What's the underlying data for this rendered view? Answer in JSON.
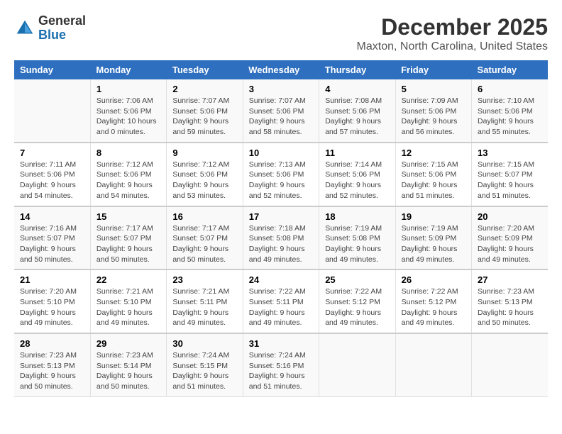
{
  "header": {
    "logo_general": "General",
    "logo_blue": "Blue",
    "month_title": "December 2025",
    "location": "Maxton, North Carolina, United States"
  },
  "days_of_week": [
    "Sunday",
    "Monday",
    "Tuesday",
    "Wednesday",
    "Thursday",
    "Friday",
    "Saturday"
  ],
  "weeks": [
    [
      {
        "num": "",
        "info": ""
      },
      {
        "num": "1",
        "info": "Sunrise: 7:06 AM\nSunset: 5:06 PM\nDaylight: 10 hours\nand 0 minutes."
      },
      {
        "num": "2",
        "info": "Sunrise: 7:07 AM\nSunset: 5:06 PM\nDaylight: 9 hours\nand 59 minutes."
      },
      {
        "num": "3",
        "info": "Sunrise: 7:07 AM\nSunset: 5:06 PM\nDaylight: 9 hours\nand 58 minutes."
      },
      {
        "num": "4",
        "info": "Sunrise: 7:08 AM\nSunset: 5:06 PM\nDaylight: 9 hours\nand 57 minutes."
      },
      {
        "num": "5",
        "info": "Sunrise: 7:09 AM\nSunset: 5:06 PM\nDaylight: 9 hours\nand 56 minutes."
      },
      {
        "num": "6",
        "info": "Sunrise: 7:10 AM\nSunset: 5:06 PM\nDaylight: 9 hours\nand 55 minutes."
      }
    ],
    [
      {
        "num": "7",
        "info": "Sunrise: 7:11 AM\nSunset: 5:06 PM\nDaylight: 9 hours\nand 54 minutes."
      },
      {
        "num": "8",
        "info": "Sunrise: 7:12 AM\nSunset: 5:06 PM\nDaylight: 9 hours\nand 54 minutes."
      },
      {
        "num": "9",
        "info": "Sunrise: 7:12 AM\nSunset: 5:06 PM\nDaylight: 9 hours\nand 53 minutes."
      },
      {
        "num": "10",
        "info": "Sunrise: 7:13 AM\nSunset: 5:06 PM\nDaylight: 9 hours\nand 52 minutes."
      },
      {
        "num": "11",
        "info": "Sunrise: 7:14 AM\nSunset: 5:06 PM\nDaylight: 9 hours\nand 52 minutes."
      },
      {
        "num": "12",
        "info": "Sunrise: 7:15 AM\nSunset: 5:06 PM\nDaylight: 9 hours\nand 51 minutes."
      },
      {
        "num": "13",
        "info": "Sunrise: 7:15 AM\nSunset: 5:07 PM\nDaylight: 9 hours\nand 51 minutes."
      }
    ],
    [
      {
        "num": "14",
        "info": "Sunrise: 7:16 AM\nSunset: 5:07 PM\nDaylight: 9 hours\nand 50 minutes."
      },
      {
        "num": "15",
        "info": "Sunrise: 7:17 AM\nSunset: 5:07 PM\nDaylight: 9 hours\nand 50 minutes."
      },
      {
        "num": "16",
        "info": "Sunrise: 7:17 AM\nSunset: 5:07 PM\nDaylight: 9 hours\nand 50 minutes."
      },
      {
        "num": "17",
        "info": "Sunrise: 7:18 AM\nSunset: 5:08 PM\nDaylight: 9 hours\nand 49 minutes."
      },
      {
        "num": "18",
        "info": "Sunrise: 7:19 AM\nSunset: 5:08 PM\nDaylight: 9 hours\nand 49 minutes."
      },
      {
        "num": "19",
        "info": "Sunrise: 7:19 AM\nSunset: 5:09 PM\nDaylight: 9 hours\nand 49 minutes."
      },
      {
        "num": "20",
        "info": "Sunrise: 7:20 AM\nSunset: 5:09 PM\nDaylight: 9 hours\nand 49 minutes."
      }
    ],
    [
      {
        "num": "21",
        "info": "Sunrise: 7:20 AM\nSunset: 5:10 PM\nDaylight: 9 hours\nand 49 minutes."
      },
      {
        "num": "22",
        "info": "Sunrise: 7:21 AM\nSunset: 5:10 PM\nDaylight: 9 hours\nand 49 minutes."
      },
      {
        "num": "23",
        "info": "Sunrise: 7:21 AM\nSunset: 5:11 PM\nDaylight: 9 hours\nand 49 minutes."
      },
      {
        "num": "24",
        "info": "Sunrise: 7:22 AM\nSunset: 5:11 PM\nDaylight: 9 hours\nand 49 minutes."
      },
      {
        "num": "25",
        "info": "Sunrise: 7:22 AM\nSunset: 5:12 PM\nDaylight: 9 hours\nand 49 minutes."
      },
      {
        "num": "26",
        "info": "Sunrise: 7:22 AM\nSunset: 5:12 PM\nDaylight: 9 hours\nand 49 minutes."
      },
      {
        "num": "27",
        "info": "Sunrise: 7:23 AM\nSunset: 5:13 PM\nDaylight: 9 hours\nand 50 minutes."
      }
    ],
    [
      {
        "num": "28",
        "info": "Sunrise: 7:23 AM\nSunset: 5:13 PM\nDaylight: 9 hours\nand 50 minutes."
      },
      {
        "num": "29",
        "info": "Sunrise: 7:23 AM\nSunset: 5:14 PM\nDaylight: 9 hours\nand 50 minutes."
      },
      {
        "num": "30",
        "info": "Sunrise: 7:24 AM\nSunset: 5:15 PM\nDaylight: 9 hours\nand 51 minutes."
      },
      {
        "num": "31",
        "info": "Sunrise: 7:24 AM\nSunset: 5:16 PM\nDaylight: 9 hours\nand 51 minutes."
      },
      {
        "num": "",
        "info": ""
      },
      {
        "num": "",
        "info": ""
      },
      {
        "num": "",
        "info": ""
      }
    ]
  ]
}
